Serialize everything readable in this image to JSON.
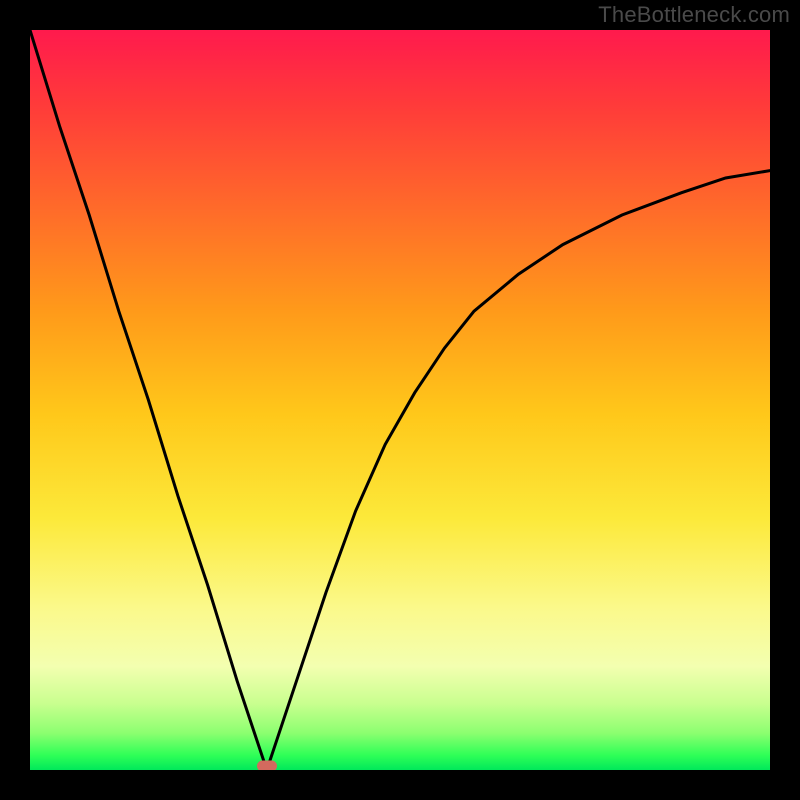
{
  "watermark": "TheBottleneck.com",
  "colors": {
    "background": "#000000",
    "curve": "#000000",
    "marker": "#d36a5e",
    "gradient_top": "#ff1a4d",
    "gradient_bottom": "#00e85a"
  },
  "chart_data": {
    "type": "line",
    "title": "",
    "xlabel": "",
    "ylabel": "",
    "xlim": [
      0,
      100
    ],
    "ylim": [
      0,
      100
    ],
    "grid": false,
    "series": [
      {
        "name": "bottleneck-curve",
        "note": "V-shaped curve; minimum near x≈32 touching y≈0; left branch rises steeply to top-left corner; right branch rises with decreasing slope toward upper-right, leveling near y≈81 at x=100. Values estimated from pixel positions.",
        "x": [
          0,
          4,
          8,
          12,
          16,
          20,
          24,
          28,
          31,
          32,
          33,
          36,
          40,
          44,
          48,
          52,
          56,
          60,
          66,
          72,
          80,
          88,
          94,
          100
        ],
        "y": [
          100,
          87,
          75,
          62,
          50,
          37,
          25,
          12,
          3,
          0,
          3,
          12,
          24,
          35,
          44,
          51,
          57,
          62,
          67,
          71,
          75,
          78,
          80,
          81
        ]
      }
    ],
    "annotations": [
      {
        "name": "min-marker",
        "x": 32,
        "y": 0,
        "shape": "pill",
        "color": "#d36a5e"
      }
    ]
  }
}
